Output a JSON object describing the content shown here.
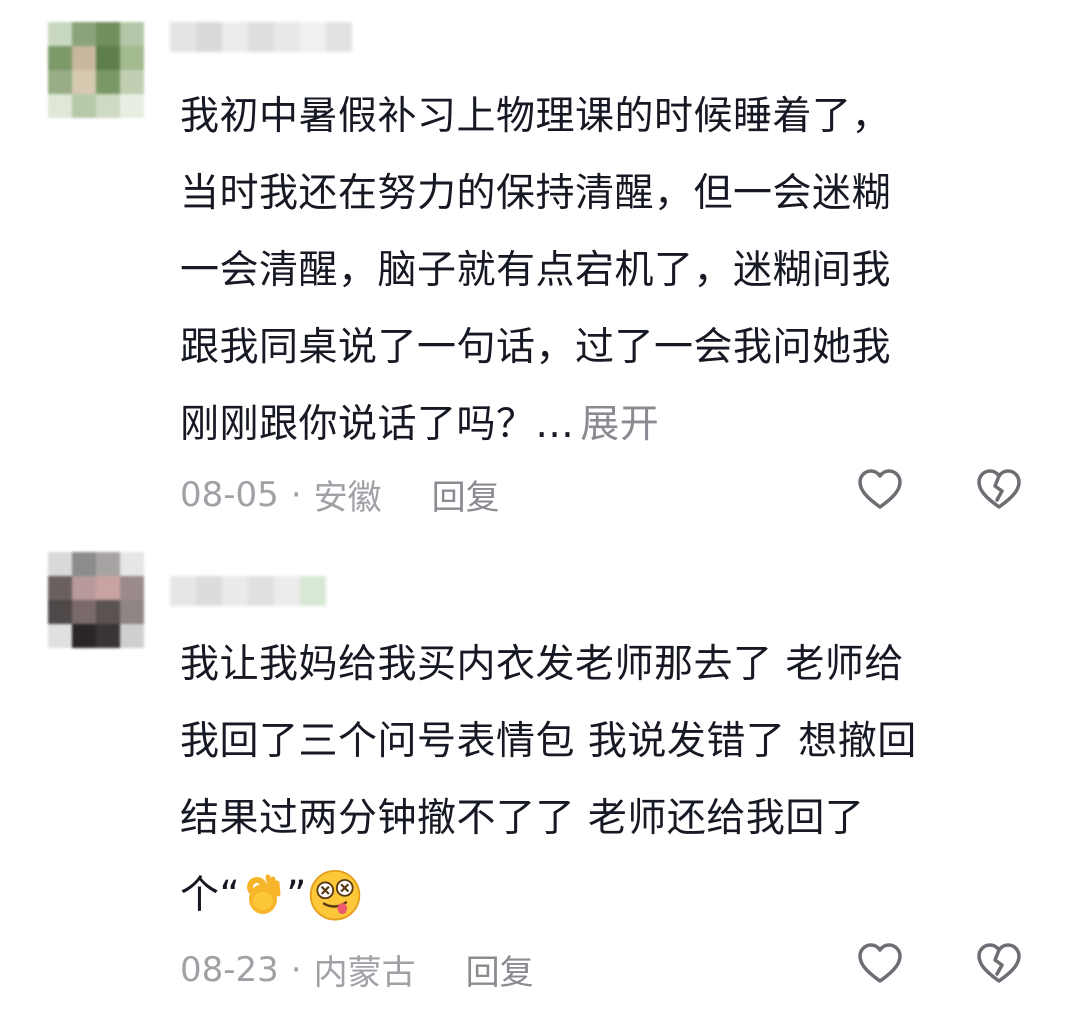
{
  "comments": [
    {
      "lines": [
        "我初中暑假补习上物理课的时候睡着了，",
        "当时我还在努力的保持清醒，但一会迷糊",
        "一会清醒，脑子就有点宕机了，迷糊间我",
        "跟我同桌说了一句话，过了一会我问她我",
        "刚刚跟你说话了吗？..."
      ],
      "expand_label": "展开",
      "date": "08-05",
      "separator": "·",
      "location": "安徽",
      "reply_label": "回复",
      "avatar_colors": [
        "#c9d8c0",
        "#8aa37a",
        "#6f8f5d",
        "#b5c7a8",
        "#7c9a68",
        "#c8b79c",
        "#5e7f4b",
        "#a3b98f",
        "#98ad86",
        "#d6c9b0",
        "#7a9866",
        "#c0cfb2",
        "#dfe7d8",
        "#b8c9aa",
        "#cfdac4",
        "#e8eee2"
      ]
    },
    {
      "lines": [
        "我让我妈给我买内衣发老师那去了 老师给",
        "我回了三个问号表情包 我说发错了 想撤回",
        "结果过两分钟撤不了了 老师还给我回了"
      ],
      "last_line_prefix": "个“",
      "last_line_suffix": "”",
      "emoji_names": [
        "ok-hand-emoji",
        "dizzy-face-emoji"
      ],
      "date": "08-23",
      "separator": "·",
      "location": "内蒙古",
      "reply_label": "回复",
      "avatar_colors": [
        "#d9d9d9",
        "#8c8c8c",
        "#a8a3a3",
        "#e6e6e6",
        "#6b6060",
        "#b89a9a",
        "#c9a3a3",
        "#9b8a8a",
        "#4f4848",
        "#7a6a6a",
        "#5b5252",
        "#8f8585",
        "#e0e0e0",
        "#2b2626",
        "#3a3434",
        "#cfcfcf"
      ]
    }
  ],
  "colors": {
    "text": "#161823",
    "meta": "#a0a1a6",
    "icon": "#6d6e74"
  }
}
